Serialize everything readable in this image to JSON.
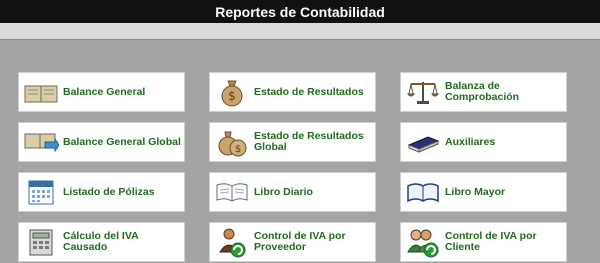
{
  "window": {
    "title": "Reportes de Contabilidad"
  },
  "menu": [
    {
      "label": "Balance General",
      "icon": "ledger-book-icon"
    },
    {
      "label": "Estado de Resultados",
      "icon": "money-bag-icon"
    },
    {
      "label": "Balanza de Comprobación",
      "icon": "scale-icon"
    },
    {
      "label": "Balance General Global",
      "icon": "ledger-book-arrow-icon"
    },
    {
      "label": "Estado de Resultados Global",
      "icon": "money-bags-icon"
    },
    {
      "label": "Auxiliares",
      "icon": "book-stack-icon"
    },
    {
      "label": "Listado de Pólizas",
      "icon": "calendar-icon"
    },
    {
      "label": "Libro Diario",
      "icon": "open-book-icon"
    },
    {
      "label": "Libro Mayor",
      "icon": "open-book-blue-icon"
    },
    {
      "label": "Cálculo del IVA Causado",
      "icon": "calculator-icon"
    },
    {
      "label": "Control de IVA por Proveedor",
      "icon": "person-refresh-icon"
    },
    {
      "label": "Control de IVA por Cliente",
      "icon": "people-refresh-icon"
    }
  ]
}
